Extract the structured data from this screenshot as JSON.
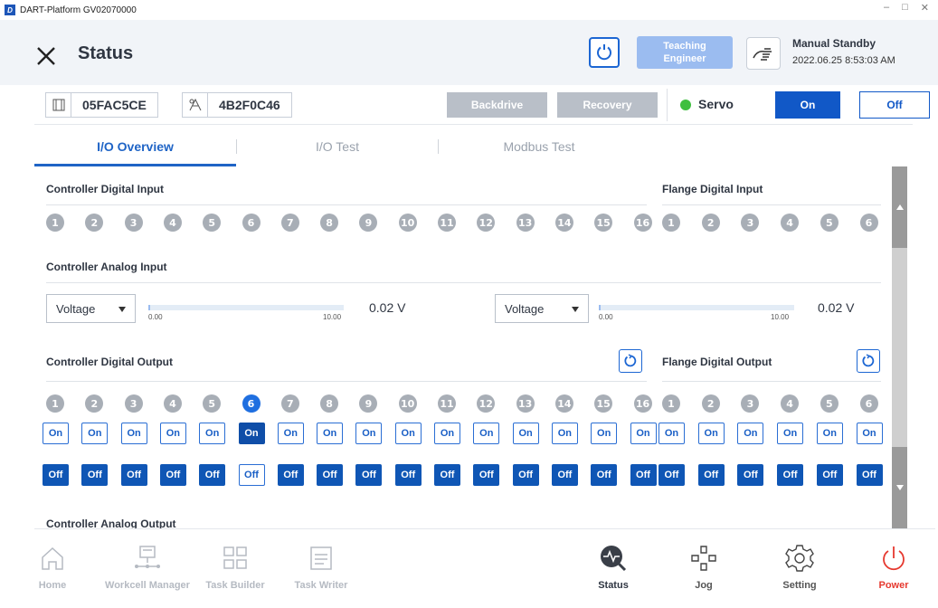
{
  "window": {
    "title": "DART-Platform GV02070000",
    "app_logo": "D"
  },
  "header": {
    "title": "Status",
    "teaching_line1": "Teaching",
    "teaching_line2": "Engineer",
    "mode": "Manual Standby",
    "datetime": "2022.06.25 8:53:03 AM"
  },
  "info": {
    "robot_id": "05FAC5CE",
    "controller_id": "4B2F0C46",
    "backdrive": "Backdrive",
    "recovery": "Recovery",
    "servo_label": "Servo",
    "servo_on": "On",
    "servo_off": "Off",
    "colors": {
      "servo_status": "#3fbf3f",
      "accent": "#1158c7"
    }
  },
  "tabs": [
    {
      "label": "I/O Overview",
      "active": true
    },
    {
      "label": "I/O Test",
      "active": false
    },
    {
      "label": "Modbus Test",
      "active": false
    }
  ],
  "sections": {
    "controller_digital_input": "Controller Digital Input",
    "flange_digital_input": "Flange Digital Input",
    "controller_analog_input": "Controller Analog Input",
    "controller_digital_output": "Controller Digital Output",
    "flange_digital_output": "Flange Digital Output",
    "controller_analog_output": "Controller Analog Output"
  },
  "controller_inputs": [
    "1",
    "2",
    "3",
    "4",
    "5",
    "6",
    "7",
    "8",
    "9",
    "10",
    "11",
    "12",
    "13",
    "14",
    "15",
    "16"
  ],
  "flange_inputs": [
    "1",
    "2",
    "3",
    "4",
    "5",
    "6"
  ],
  "analog_inputs": [
    {
      "mode": "Voltage",
      "min": "0.00",
      "max": "10.00",
      "value": "0.02 V",
      "level": 0.002
    },
    {
      "mode": "Voltage",
      "min": "0.00",
      "max": "10.00",
      "value": "0.02 V",
      "level": 0.002
    }
  ],
  "controller_outputs": {
    "numbers": [
      "1",
      "2",
      "3",
      "4",
      "5",
      "6",
      "7",
      "8",
      "9",
      "10",
      "11",
      "12",
      "13",
      "14",
      "15",
      "16"
    ],
    "active_index": 6,
    "on_label": "On",
    "off_label": "Off"
  },
  "flange_outputs": {
    "numbers": [
      "1",
      "2",
      "3",
      "4",
      "5",
      "6"
    ],
    "on_label": "On",
    "off_label": "Off"
  },
  "bottom_nav": [
    {
      "label": "Home",
      "icon": "home-icon"
    },
    {
      "label": "Workcell Manager",
      "icon": "workcell-icon"
    },
    {
      "label": "Task Builder",
      "icon": "task-builder-icon"
    },
    {
      "label": "Task Writer",
      "icon": "task-writer-icon"
    },
    {
      "label": "Status",
      "icon": "status-icon"
    },
    {
      "label": "Jog",
      "icon": "jog-icon"
    },
    {
      "label": "Setting",
      "icon": "gear-icon"
    },
    {
      "label": "Power",
      "icon": "power-icon"
    }
  ]
}
